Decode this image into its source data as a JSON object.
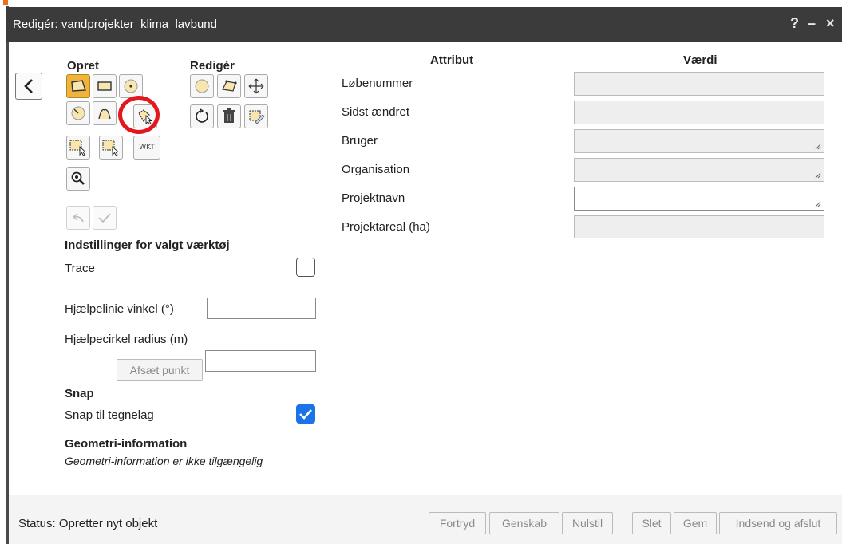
{
  "dialog": {
    "title": "Redigér: vandprojekter_klima_lavbund",
    "help_label": "?",
    "minimize_label": "–",
    "close_label": "×"
  },
  "tools": {
    "create_heading": "Opret",
    "edit_heading": "Redigér",
    "create_items": [
      "draw-polygon",
      "draw-rectangle",
      "draw-circle",
      "draw-circle-small",
      "draw-freehand",
      "select-polygon",
      "select-area",
      "select-area-2",
      "wkt",
      "zoom-to"
    ],
    "wkt_label": "WKT",
    "edit_items": [
      "edit-circle",
      "edit-vertices",
      "move",
      "rotate",
      "delete",
      "split"
    ]
  },
  "settings": {
    "heading": "Indstillinger for valgt værktøj",
    "trace_label": "Trace",
    "trace_checked": false,
    "angle_label": "Hjælpelinie vinkel (°)",
    "angle_value": "",
    "radius_label": "Hjælpecirkel radius (m)",
    "radius_value": "",
    "place_point_label": "Afsæt punkt"
  },
  "snap": {
    "heading": "Snap",
    "label": "Snap til tegnelag",
    "checked": true
  },
  "geometry": {
    "heading": "Geometri-information",
    "text": "Geometri-information er ikke tilgængelig"
  },
  "attributes": {
    "col_attribute": "Attribut",
    "col_value": "Værdi",
    "rows": [
      {
        "label": "Løbenummer",
        "value": "",
        "readonly": true
      },
      {
        "label": "Sidst ændret",
        "value": "",
        "readonly": true
      },
      {
        "label": "Bruger",
        "value": "",
        "readonly": true
      },
      {
        "label": "Organisation",
        "value": "",
        "readonly": true
      },
      {
        "label": "Projektnavn",
        "value": "",
        "readonly": false
      },
      {
        "label": "Projektareal (ha)",
        "value": "",
        "readonly": true
      }
    ]
  },
  "status": {
    "text": "Status: Opretter nyt objekt"
  },
  "footer_buttons": {
    "undo": "Fortryd",
    "redo": "Genskab",
    "reset": "Nulstil",
    "delete": "Slet",
    "save": "Gem",
    "submit_close": "Indsend og afslut"
  },
  "colors": {
    "titlebar": "#3b3b3b",
    "active_tool": "#f0b43a",
    "highlight": "#e3171e",
    "checkbox_on": "#1a73e8"
  }
}
